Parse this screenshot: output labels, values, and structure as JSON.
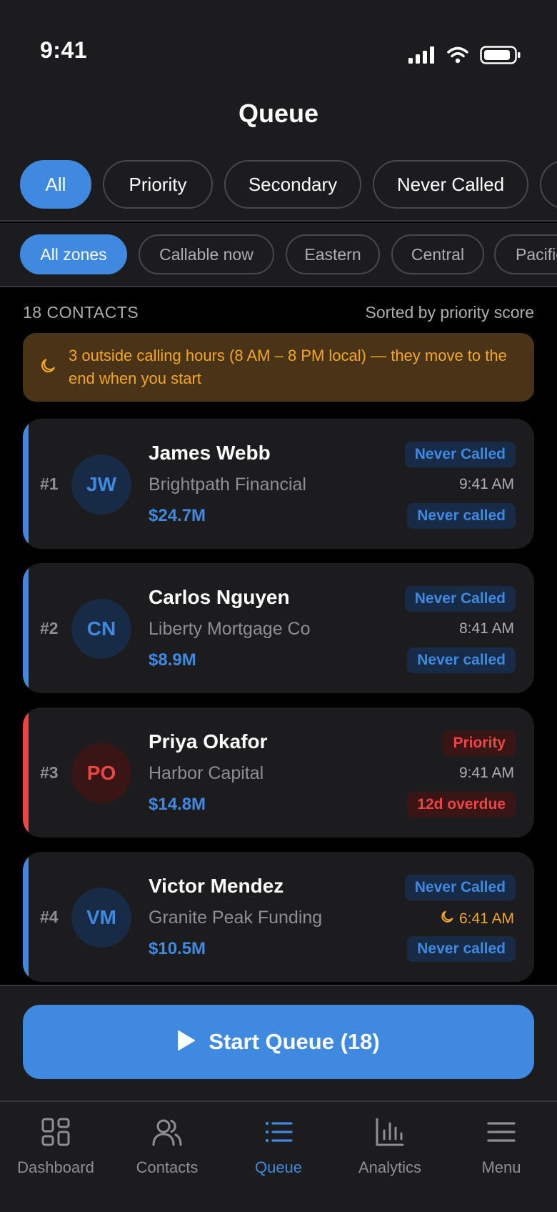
{
  "status": {
    "time": "9:41"
  },
  "header": {
    "title": "Queue"
  },
  "filters": [
    {
      "label": "All",
      "active": true
    },
    {
      "label": "Priority",
      "active": false
    },
    {
      "label": "Secondary",
      "active": false
    },
    {
      "label": "Never Called",
      "active": false
    }
  ],
  "zones": [
    {
      "label": "All zones",
      "active": true
    },
    {
      "label": "Callable now",
      "active": false
    },
    {
      "label": "Eastern",
      "active": false
    },
    {
      "label": "Central",
      "active": false
    },
    {
      "label": "Pacific",
      "active": false
    }
  ],
  "list": {
    "count_label": "18 CONTACTS",
    "sort_label": "Sorted by priority score"
  },
  "banner": {
    "text": "3 outside calling hours (8 AM – 8 PM local) — they move to the end when you start",
    "icon": "moon-icon"
  },
  "contacts": [
    {
      "rank": "#1",
      "initials": "JW",
      "name": "James Webb",
      "company": "Brightpath Financial",
      "amount": "$24.7M",
      "category": "Never Called",
      "time": "9:41 AM",
      "status": "Never called",
      "accent": "#3f8ae0",
      "after_hours": false
    },
    {
      "rank": "#2",
      "initials": "CN",
      "name": "Carlos Nguyen",
      "company": "Liberty Mortgage Co",
      "amount": "$8.9M",
      "category": "Never Called",
      "time": "8:41 AM",
      "status": "Never called",
      "accent": "#3f8ae0",
      "after_hours": false
    },
    {
      "rank": "#3",
      "initials": "PO",
      "name": "Priya Okafor",
      "company": "Harbor Capital",
      "amount": "$14.8M",
      "category": "Priority",
      "time": "9:41 AM",
      "status": "12d overdue",
      "accent": "#ef4444",
      "after_hours": false
    },
    {
      "rank": "#4",
      "initials": "VM",
      "name": "Victor Mendez",
      "company": "Granite Peak Funding",
      "amount": "$10.5M",
      "category": "Never Called",
      "time": "6:41 AM",
      "status": "Never called",
      "accent": "#3f8ae0",
      "after_hours": true
    }
  ],
  "cta": {
    "label": "Start Queue (18)",
    "icon": "play-icon"
  },
  "tabs": [
    {
      "label": "Dashboard",
      "icon": "dashboard-icon",
      "active": false
    },
    {
      "label": "Contacts",
      "icon": "contacts-icon",
      "active": false
    },
    {
      "label": "Queue",
      "icon": "queue-icon",
      "active": true
    },
    {
      "label": "Analytics",
      "icon": "analytics-icon",
      "active": false
    },
    {
      "label": "Menu",
      "icon": "menu-icon",
      "active": false
    }
  ],
  "colors": {
    "accent": "#3f8ae0",
    "priority": "#ef4444",
    "warning": "#f5a623",
    "surface": "#1c1c1e",
    "background": "#000000"
  }
}
